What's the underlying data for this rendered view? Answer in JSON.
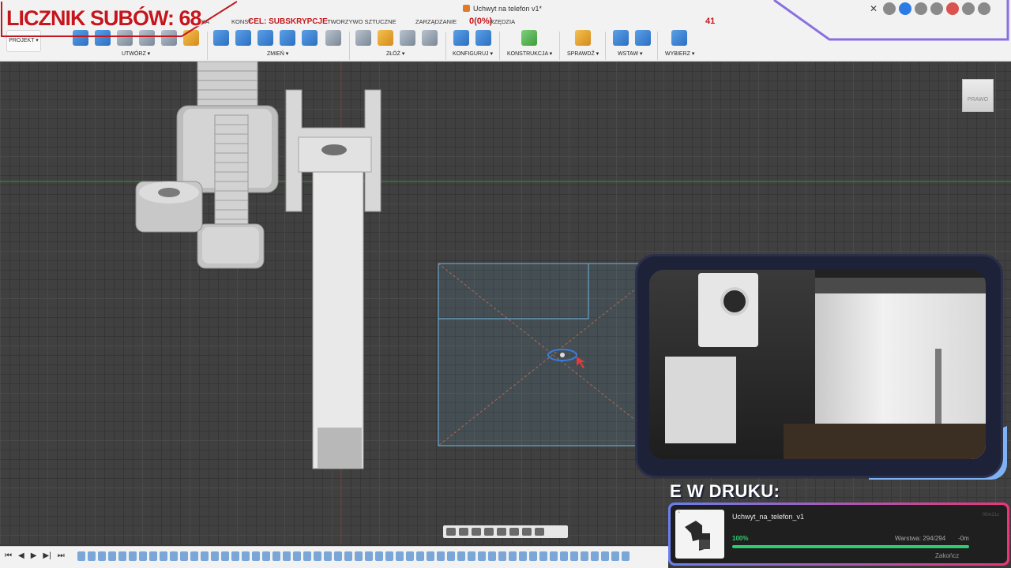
{
  "app": {
    "doc_title": "Uchwyt na telefon v1*"
  },
  "overlay": {
    "sub_counter": "LICZNIK SUBÓW: 68",
    "goal_label": "CEL: SUBSKRYPCJE",
    "goal_progress": "0(0%)",
    "goal_target": "41",
    "print_header": "E W DRUKU:"
  },
  "toolbar": {
    "project_label": "PROJEKT",
    "tabs": {
      "solid": "KA",
      "konst": "KONST",
      "plastic": "TWORZYWO SZTUCZNE",
      "manage": "ZARZĄDZANIE",
      "tools": "RZĘDZIA"
    },
    "groups": {
      "create": "UTWÓRZ ▾",
      "modify": "ZMIEŃ ▾",
      "assemble": "ZŁÓŻ ▾",
      "configure": "KONFIGURUJ ▾",
      "construct": "KONSTRUKCJA ▾",
      "inspect": "SPRAWDŹ ▾",
      "insert": "WSTAW ▾",
      "select": "WYBIERZ ▾"
    }
  },
  "viewcube": {
    "face": "PRAWO"
  },
  "print_status": {
    "thumb_index": "1",
    "job_name": "Uchwyt_na_telefon_v1",
    "job_time": "00m21s",
    "progress_label": "100%",
    "progress": 1.0,
    "layer": "Warstwa: 294/294",
    "remaining": "-0m",
    "finish": "Zakończ"
  },
  "timeline": {
    "controls": [
      "⏮",
      "◀",
      "▶",
      "▶|",
      "⏭"
    ]
  },
  "colors": {
    "accent_red": "#c4161c",
    "progress_green": "#2ecc71",
    "sketch_blue": "#6fb7e0",
    "frame_navy": "#1e2238"
  }
}
